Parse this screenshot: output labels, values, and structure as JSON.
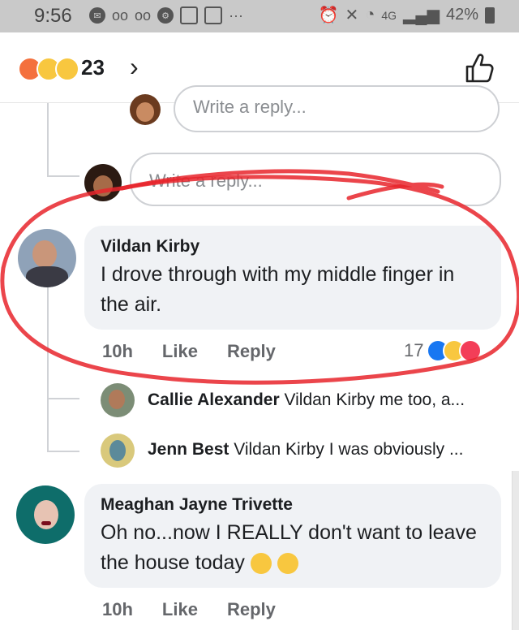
{
  "status_bar": {
    "time": "9:56",
    "network": "4G",
    "battery": "42%"
  },
  "header": {
    "reaction_count": "23",
    "chevron": "›",
    "reactions": [
      "angry-emoji",
      "wow-emoji",
      "sad-emoji"
    ]
  },
  "reply_placeholder_top": "Write a reply...",
  "reply_placeholder_second": "Write a reply...",
  "comments": [
    {
      "author": "Vildan Kirby",
      "text": "I drove through with my middle finger in the air.",
      "time": "10h",
      "like": "Like",
      "reply": "Reply",
      "reaction_count": "17",
      "reactions": [
        "like-reaction",
        "haha-reaction",
        "love-reaction"
      ]
    },
    {
      "author": "Meaghan Jayne Trivette",
      "text": "Oh no...now I REALLY don't want to leave the house today",
      "time": "10h",
      "like": "Like",
      "reply": "Reply"
    }
  ],
  "replies": [
    {
      "author": "Callie Alexander",
      "text": "Vildan Kirby me too, a..."
    },
    {
      "author": "Jenn Best",
      "text": "Vildan Kirby  I was obviously ..."
    }
  ],
  "colors": {
    "accent_blue": "#1877f2",
    "red_annotation": "#e8242b",
    "bubble_bg": "#f0f2f5"
  }
}
